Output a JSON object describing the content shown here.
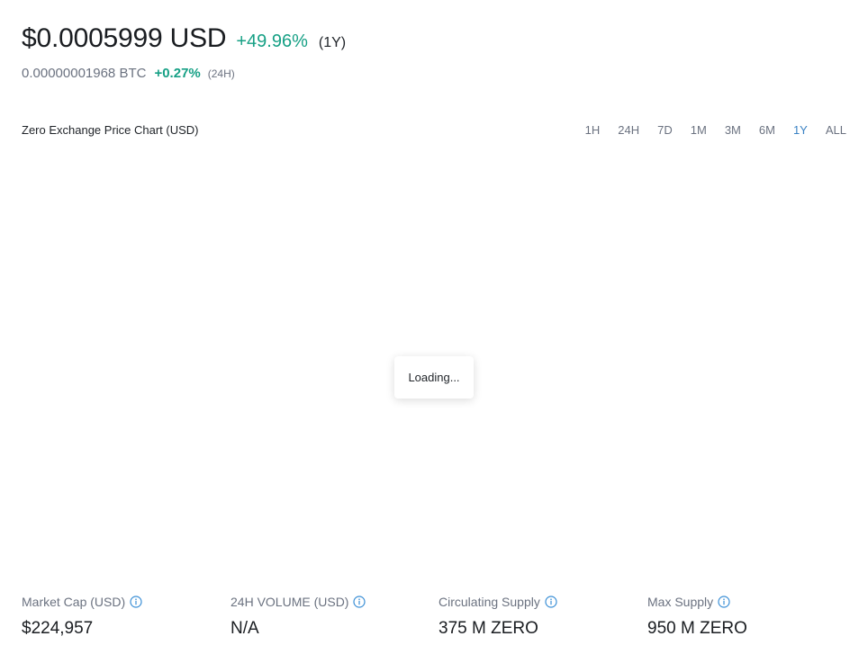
{
  "price": {
    "usd_value": "$0.0005999 USD",
    "usd_change": "+49.96%",
    "usd_period": "(1Y)",
    "btc_value": "0.00000001968 BTC",
    "btc_change": "+0.27%",
    "btc_period": "(24H)"
  },
  "chart": {
    "title": "Zero Exchange Price Chart (USD)",
    "ranges": [
      "1H",
      "24H",
      "7D",
      "1M",
      "3M",
      "6M",
      "1Y",
      "ALL"
    ],
    "active_range": "1Y",
    "loading_text": "Loading..."
  },
  "stats": [
    {
      "label": "Market Cap (USD)",
      "value": "$224,957"
    },
    {
      "label": "24H VOLUME (USD)",
      "value": "N/A"
    },
    {
      "label": "Circulating Supply",
      "value": "375 M ZERO"
    },
    {
      "label": "Max Supply",
      "value": "950 M ZERO"
    }
  ],
  "colors": {
    "positive": "#16a085",
    "active_tab": "#3b82c4",
    "info_icon": "#3b8fd6"
  }
}
